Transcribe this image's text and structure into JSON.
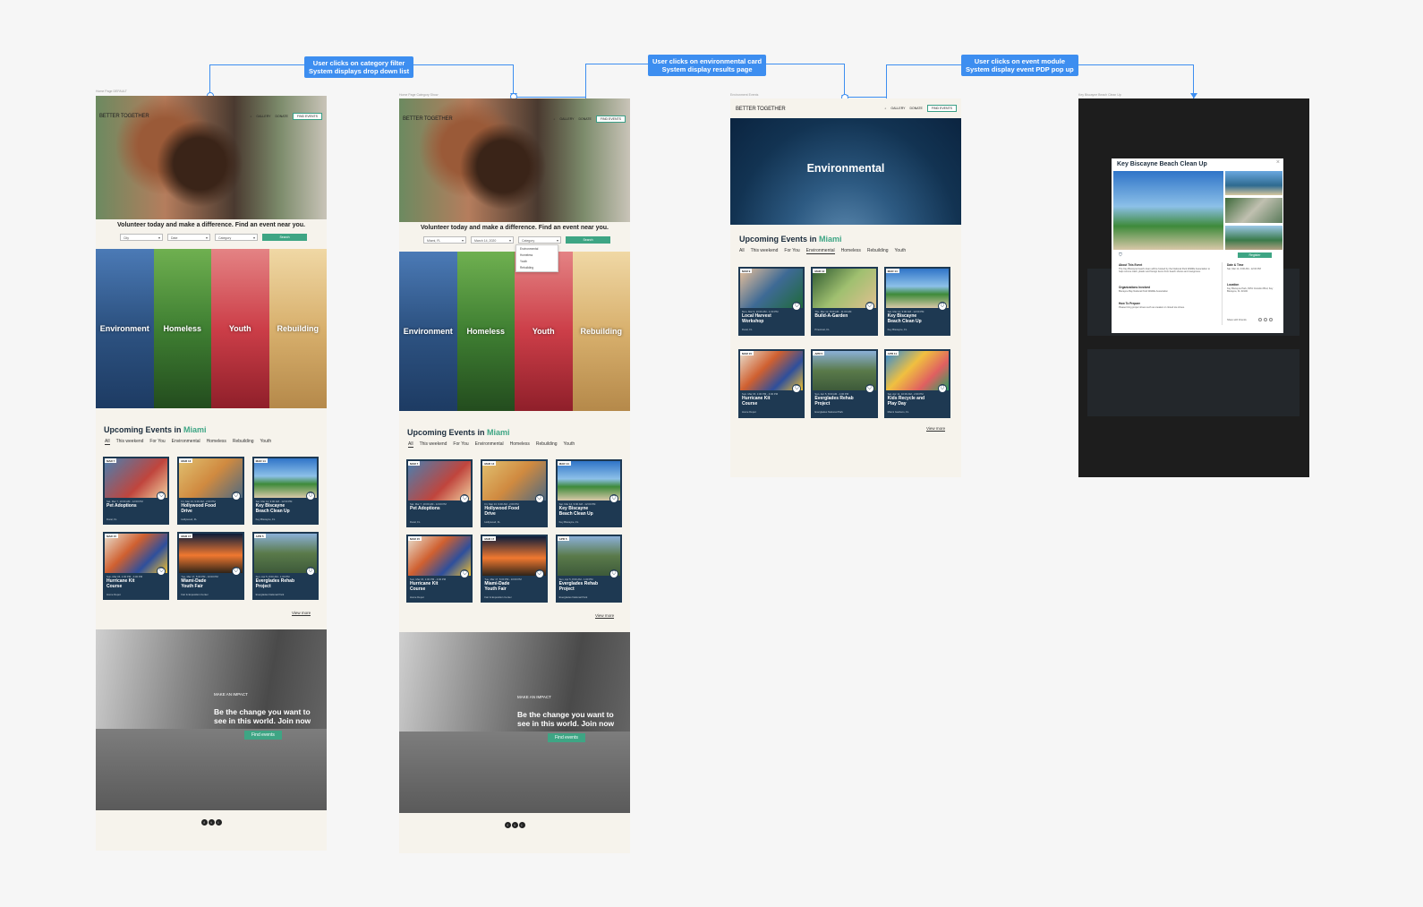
{
  "flow": {
    "callouts": [
      {
        "line1": "User clicks on category filter",
        "line2": "System displays drop down list"
      },
      {
        "line1": "User clicks on environmental card",
        "line2": "System display results page"
      },
      {
        "line1": "User clicks on event module",
        "line2": "System display event PDP pop up"
      }
    ],
    "frame_labels": [
      "Home Page DEFAULT",
      "Home Page Category Show",
      "Environment Events",
      "Key Biscayne Beach Clean Up"
    ]
  },
  "site": {
    "brand": "BETTER TOGETHER",
    "nav": {
      "gallery": "GALLERY",
      "donate": "DONATE",
      "find_events": "FIND EVENTS"
    },
    "tagline": "Volunteer today and make a difference. Find an event near you.",
    "filters_default": {
      "city": "City",
      "date": "Date",
      "category": "Category",
      "search": "Search"
    },
    "filters_selected": {
      "city": "Miami, FL",
      "date": "March 14, 2020",
      "category": "Category",
      "search": "Search"
    },
    "category_options": [
      "Environmental",
      "Homeless",
      "Youth",
      "Rebuilding"
    ],
    "categories": [
      "Environment",
      "Homeless",
      "Youth",
      "Rebuilding"
    ],
    "upcoming_prefix": "Upcoming Events in",
    "upcoming_city": "Miami",
    "tabs": [
      "All",
      "This weekend",
      "For You",
      "Environmental",
      "Homeless",
      "Rebuilding",
      "Youth"
    ],
    "view_more": "View more",
    "impact": {
      "kicker": "MAKE AN IMPACT",
      "headline_1": "Be the change you want to",
      "headline_2": "see in this world. Join now",
      "button": "Find events"
    },
    "social": [
      "f",
      "t",
      "i"
    ]
  },
  "home_events": [
    {
      "tag": "MAR 7",
      "date": "Sat, Mar 7, 10:00 AM - 12:00 PM",
      "title_1": "Pet Adoptions",
      "title_2": "",
      "loc": "Doral, FL"
    },
    {
      "tag": "MAR 13",
      "date": "Fri, Mar 13, 9:00 AM - 2:00 PM",
      "title_1": "Hollywood Food",
      "title_2": "Drive",
      "loc": "Hollywood, FL"
    },
    {
      "tag": "MAR 14",
      "date": "Sat, Mar 14, 9:00 AM - 12:00 PM",
      "title_1": "Key Biscayne",
      "title_2": "Beach Clean Up",
      "loc": "Key Biscayne, FL"
    },
    {
      "tag": "MAR 15",
      "date": "Sun, Mar 15, 1:00 PM - 4:00 PM",
      "title_1": "Hurricane Kit",
      "title_2": "Course",
      "loc": "Home Depot"
    },
    {
      "tag": "MAR 17",
      "date": "Tue, Mar 17, 5:00 PM - 10:00 PM",
      "title_1": "Miami-Dade",
      "title_2": "Youth Fair",
      "loc": "Fair & Exposition Center"
    },
    {
      "tag": "APR 5",
      "date": "Sun, Apr 5, 8:00 AM - 1:00 PM",
      "title_1": "Everglades Rehab",
      "title_2": "Project",
      "loc": "Everglades National Park"
    }
  ],
  "env_events": [
    {
      "tag": "MAR 9",
      "date": "Mon, Mar 9, 10:00 AM - 1:00 PM",
      "title_1": "Local Harvest",
      "title_2": "Workshop",
      "loc": "Doral, FL"
    },
    {
      "tag": "MAR 12",
      "date": "Thu, Mar 12, 8:00 AM - 11:00 AM",
      "title_1": "Build-A-Garden",
      "title_2": "",
      "loc": "Pinecrest, FL"
    },
    {
      "tag": "MAR 14",
      "date": "Sat, Mar 14, 9:00 AM - 12:00 PM",
      "title_1": "Key Biscayne",
      "title_2": "Beach Clean Up",
      "loc": "Key Biscayne, FL"
    },
    {
      "tag": "MAR 15",
      "date": "Sun, Mar 15, 1:00 PM - 4:00 PM",
      "title_1": "Hurricane Kit",
      "title_2": "Course",
      "loc": "Home Depot"
    },
    {
      "tag": "APR 5",
      "date": "Sun, Apr 5, 8:00 AM - 1:00 PM",
      "title_1": "Everglades Rehab",
      "title_2": "Project",
      "loc": "Everglades National Park"
    },
    {
      "tag": "APR 11",
      "date": "Sat, Apr 11, 10:00 AM - 2:00 PM",
      "title_1": "Kids Recycle and",
      "title_2": "Play Day",
      "loc": "Miami Gardens, FL"
    }
  ],
  "env_page": {
    "title": "Environmental",
    "active_tab": "Environmental"
  },
  "modal": {
    "title": "Key Biscayne Beach Clean Up",
    "close": "×",
    "register": "Register",
    "about_h": "About This Event",
    "about_p": "The Key Biscayne beach clean will be hosted by the National Park Wildlife Association to help remove trash, plastic and foreign items from beach shores and mangroves.",
    "orgs_h": "Organizations Involved",
    "orgs_p": "Biscayne Bay National Park Wildlife Association",
    "prep_h": "How To Prepare",
    "prep_p": "Please bring proper shoes such as sneaker or closed toe shoes.",
    "date_h": "Date & Time",
    "date_p": "Sat, Mar 14, 9:00 AM - 12:00 PM",
    "loc_h": "Location",
    "loc_p": "Key Biscayne Park, 8151 Crandon Blvd, Key Biscayne, FL 33149",
    "share": "Share with Friends"
  },
  "colors": {
    "accent": "#3ea584",
    "card": "#1e3952",
    "flow": "#3d8ef0",
    "page": "#f6f3ec"
  }
}
